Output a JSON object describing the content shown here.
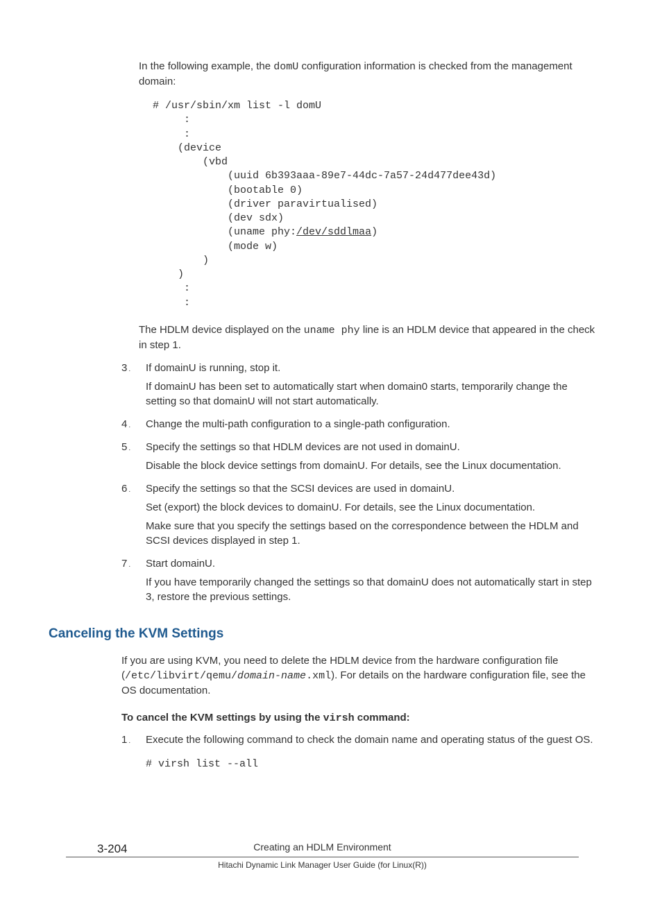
{
  "intro_p1_a": "In the following example, the ",
  "intro_p1_code": "domU",
  "intro_p1_b": " configuration information is checked from the management domain:",
  "code_block1": "# /usr/sbin/xm list -l domU\n     :\n     :\n    (device\n        (vbd\n            (uuid 6b393aaa-89e7-44dc-7a57-24d477dee43d)\n            (bootable 0)\n            (driver paravirtualised)\n            (dev sdx)\n            (uname phy:",
  "code_block1_underline": "/dev/sddlmaa",
  "code_block1_tail": ")\n            (mode w)\n        )\n    )\n     :\n     :",
  "after_code_a": "The HDLM device displayed on the ",
  "after_code_code": "uname phy",
  "after_code_b": " line is an HDLM device that appeared in the check in step 1.",
  "step3_num": "3",
  "step3_l1": "If domainU is running, stop it.",
  "step3_l2": "If domainU has been set to automatically start when domain0 starts, temporarily change the setting so that domainU will not start automatically.",
  "step4_num": "4",
  "step4_l1": "Change the multi-path configuration to a single-path configuration.",
  "step5_num": "5",
  "step5_l1": "Specify the settings so that HDLM devices are not used in domainU.",
  "step5_l2": "Disable the block device settings from domainU. For details, see the Linux documentation.",
  "step6_num": "6",
  "step6_l1": "Specify the settings so that the SCSI devices are used in domainU.",
  "step6_l2": "Set (export) the block devices to domainU. For details, see the Linux documentation.",
  "step6_l3": "Make sure that you specify the settings based on the correspondence between the HDLM and SCSI devices displayed in step 1.",
  "step7_num": "7",
  "step7_l1": "Start domainU.",
  "step7_l2": "If you have temporarily changed the settings so that domainU does not automatically start in step 3, restore the previous settings.",
  "section_heading": "Canceling the KVM Settings",
  "kvm_p1_a": "If you are using KVM, you need to delete the HDLM device from the hardware configuration file (",
  "kvm_p1_code1": "/etc/libvirt/qemu/",
  "kvm_p1_code_italic": "domain-name",
  "kvm_p1_code2": ".xml",
  "kvm_p1_b": "). For details on the hardware configuration file, see the OS documentation.",
  "kvm_sub_a": "To cancel the KVM settings by using the ",
  "kvm_sub_code": "virsh",
  "kvm_sub_b": " command:",
  "kvm_step1_num": "1",
  "kvm_step1_l1": "Execute the following command to check the domain name and operating status of the guest OS.",
  "code_block2": "# virsh list --all",
  "page_number": "3-204",
  "footer_title": "Creating an HDLM Environment",
  "footer_sub": "Hitachi Dynamic Link Manager User Guide (for Linux(R))"
}
